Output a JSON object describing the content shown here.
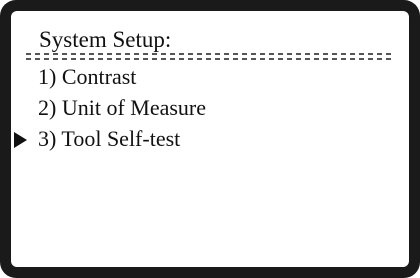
{
  "screen": {
    "title": "System Setup:"
  },
  "menu": {
    "items": [
      {
        "label": "1) Contrast",
        "selected": false
      },
      {
        "label": "2) Unit of Measure",
        "selected": false
      },
      {
        "label": "3) Tool Self-test",
        "selected": true
      }
    ]
  }
}
